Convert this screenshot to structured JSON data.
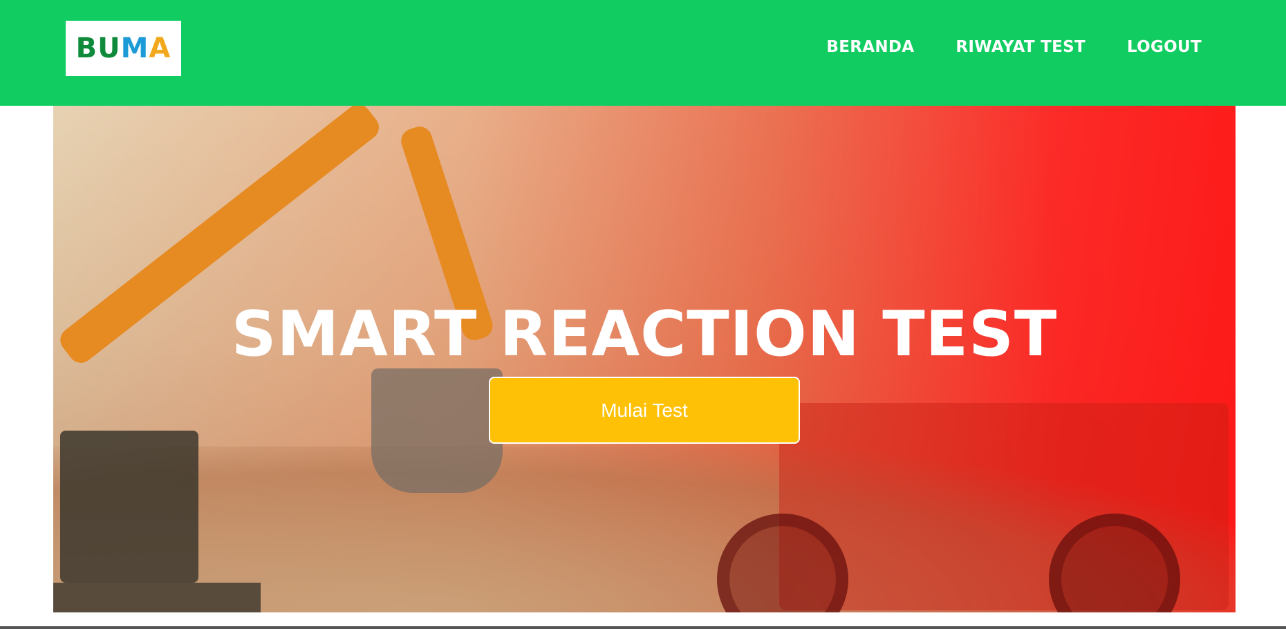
{
  "brand": {
    "logo_parts": [
      "BU",
      "M",
      "A"
    ],
    "colors": {
      "navbar": "#11cd61",
      "button": "#fec106",
      "gradient_end": "#ff1414"
    }
  },
  "nav": {
    "items": [
      {
        "label": "BERANDA"
      },
      {
        "label": "RIWAYAT TEST"
      },
      {
        "label": "LOGOUT"
      }
    ]
  },
  "hero": {
    "title": "SMART REACTION TEST",
    "divider_icon": "star-icon",
    "button_label": "Mulai Test"
  }
}
